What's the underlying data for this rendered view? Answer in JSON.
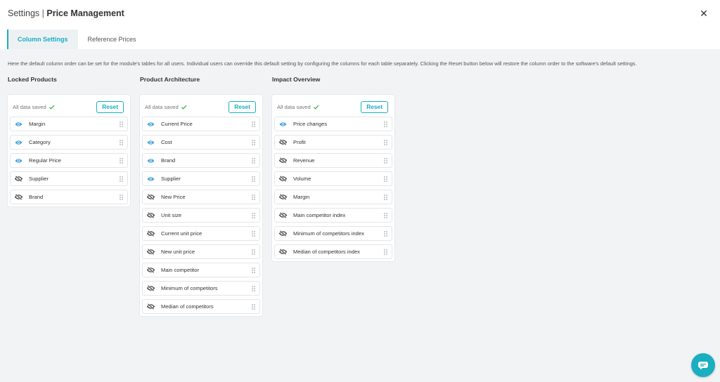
{
  "header": {
    "title_prefix": "Settings",
    "title_sep": " | ",
    "title_main": "Price Management",
    "close_glyph": "✕"
  },
  "tabs": [
    {
      "label": "Column Settings",
      "active": true
    },
    {
      "label": "Reference Prices",
      "active": false
    }
  ],
  "description": "Here the default column order can be set for the module's tables for all users. Individual users can override this default setting by configuring the columns for each table separately. Clicking the Reset button below will restore the column order to the software's default settings.",
  "colors": {
    "accent": "#1aaec1",
    "visible_icon": "#3a9fd8",
    "hidden_icon": "#444444",
    "saved_check": "#3cb54a"
  },
  "groups": [
    {
      "title": "Locked Products",
      "status": "All data saved",
      "reset_label": "Reset",
      "items": [
        {
          "label": "Margin",
          "visible": true
        },
        {
          "label": "Category",
          "visible": true
        },
        {
          "label": "Regular Price",
          "visible": true
        },
        {
          "label": "Supplier",
          "visible": false
        },
        {
          "label": "Brand",
          "visible": false
        }
      ]
    },
    {
      "title": "Product Architecture",
      "status": "All data saved",
      "reset_label": "Reset",
      "items": [
        {
          "label": "Current Price",
          "visible": true
        },
        {
          "label": "Cost",
          "visible": true
        },
        {
          "label": "Brand",
          "visible": true
        },
        {
          "label": "Supplier",
          "visible": true
        },
        {
          "label": "New Price",
          "visible": false
        },
        {
          "label": "Unit size",
          "visible": false
        },
        {
          "label": "Current unit price",
          "visible": false
        },
        {
          "label": "New unit price",
          "visible": false
        },
        {
          "label": "Main competitor",
          "visible": false
        },
        {
          "label": "Minimum of competitors",
          "visible": false
        },
        {
          "label": "Median of competitors",
          "visible": false
        }
      ]
    },
    {
      "title": "Impact Overview",
      "status": "All data saved",
      "reset_label": "Reset",
      "items": [
        {
          "label": "Price changes",
          "visible": true
        },
        {
          "label": "Profit",
          "visible": false
        },
        {
          "label": "Revenue",
          "visible": false
        },
        {
          "label": "Volume",
          "visible": false
        },
        {
          "label": "Margin",
          "visible": false
        },
        {
          "label": "Main competitor index",
          "visible": false
        },
        {
          "label": "Minimum of competitors index",
          "visible": false
        },
        {
          "label": "Median of competitors index",
          "visible": false
        }
      ]
    }
  ],
  "chat": {
    "icon": "chat-icon"
  }
}
